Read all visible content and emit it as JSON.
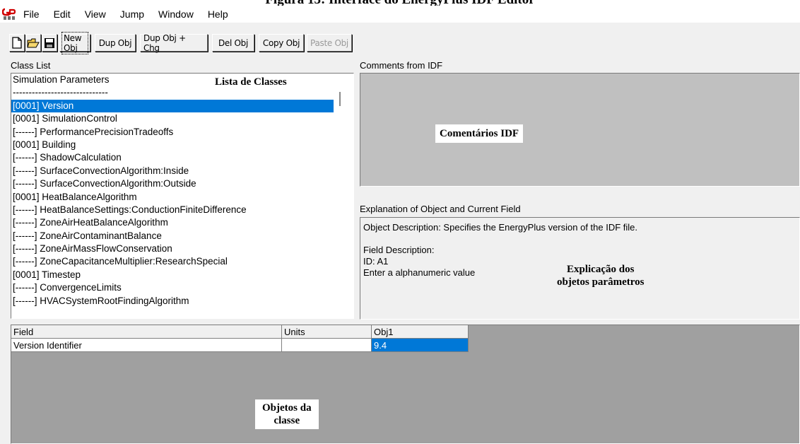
{
  "caption": "Figura 13: Interface do EnergyPlus IDF Editor",
  "menu": [
    "File",
    "Edit",
    "View",
    "Jump",
    "Window",
    "Help"
  ],
  "toolbar": {
    "new_obj": "New Obj",
    "dup_obj": "Dup Obj",
    "dup_obj_chg": "Dup Obj + Chg",
    "del_obj": "Del Obj",
    "copy_obj": "Copy Obj",
    "paste_obj": "Paste Obj"
  },
  "class_list": {
    "label": "Class List",
    "annotation": "Lista de Classes",
    "items": [
      "Simulation Parameters",
      "------------------------------",
      "[0001]  Version",
      "[0001]  SimulationControl",
      "[------]  PerformancePrecisionTradeoffs",
      "[0001]  Building",
      "[------]  ShadowCalculation",
      "[------]  SurfaceConvectionAlgorithm:Inside",
      "[------]  SurfaceConvectionAlgorithm:Outside",
      "[0001]  HeatBalanceAlgorithm",
      "[------]  HeatBalanceSettings:ConductionFiniteDifference",
      "[------]  ZoneAirHeatBalanceAlgorithm",
      "[------]  ZoneAirContaminantBalance",
      "[------]  ZoneAirMassFlowConservation",
      "[------]  ZoneCapacitanceMultiplier:ResearchSpecial",
      "[0001]  Timestep",
      "[------]  ConvergenceLimits",
      "[------]  HVACSystemRootFindingAlgorithm"
    ],
    "selected_index": 2
  },
  "comments": {
    "label": "Comments from IDF",
    "annotation": "Comentários  IDF"
  },
  "explanation": {
    "label": "Explanation of Object and Current Field",
    "object_description": "Object Description: Specifies the EnergyPlus version of the IDF file.",
    "field_description": "Field Description:",
    "field_id": "ID: A1",
    "field_hint": "Enter a alphanumeric value",
    "annotation_line1": "Explicação dos",
    "annotation_line2": "objetos parâmetros"
  },
  "grid": {
    "headers": [
      "Field",
      "Units",
      "Obj1"
    ],
    "rows": [
      {
        "field": "Version Identifier",
        "units": "",
        "obj1": "9.4"
      }
    ],
    "annotation_line1": "Objetos da",
    "annotation_line2": "classe"
  },
  "colors": {
    "selection": "#0078d7",
    "window_bg": "#f0f0f0",
    "comments_bg": "#c0c0c0",
    "grid_bg": "#a0a0a0"
  }
}
